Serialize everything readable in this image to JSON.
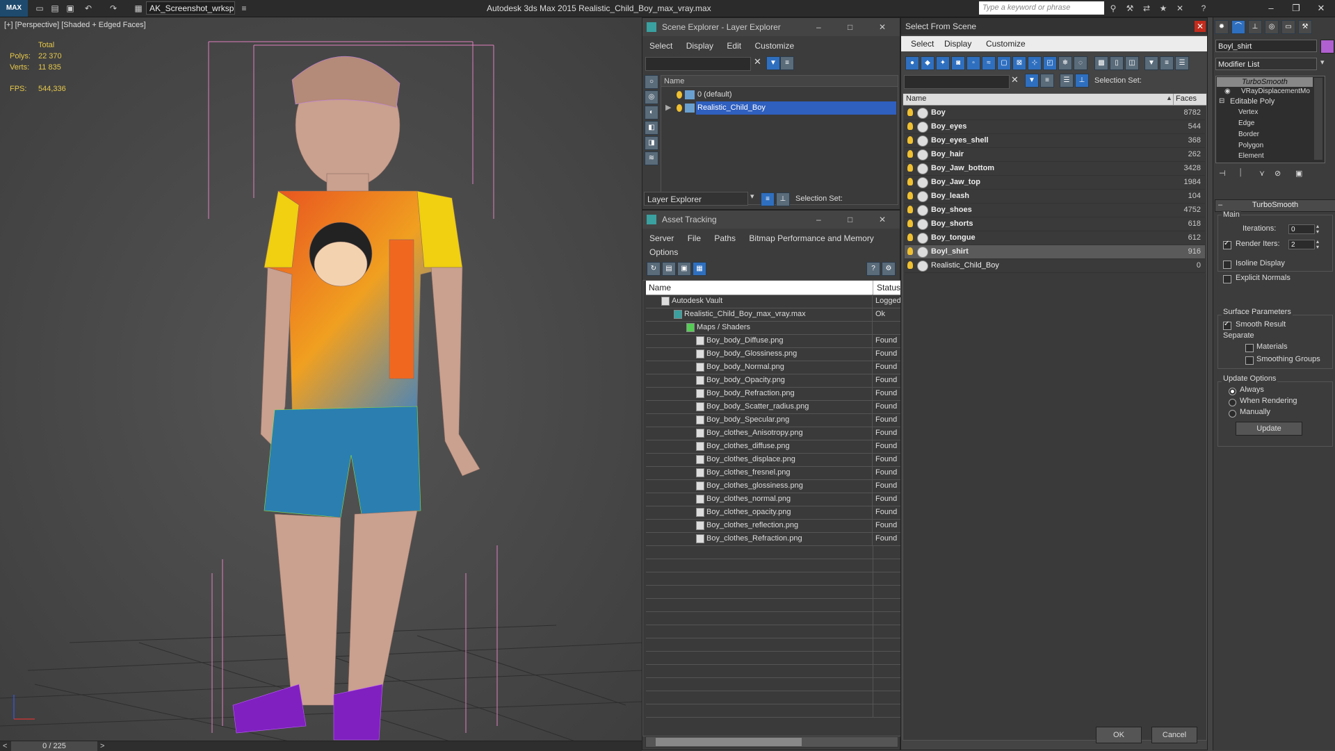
{
  "titlebar": {
    "workspace": "AK_Screenshot_wrksp",
    "app_title": "Autodesk 3ds Max  2015     Realistic_Child_Boy_max_vray.max",
    "search_placeholder": "Type a keyword or phrase",
    "logo": "MAX"
  },
  "viewport": {
    "label": "[+] [Perspective] [Shaded + Edged Faces]",
    "stats": {
      "total_label": "Total",
      "polys_label": "Polys:",
      "polys": "22 370",
      "verts_label": "Verts:",
      "verts": "11 835",
      "fps_label": "FPS:",
      "fps": "544,336"
    }
  },
  "timeline": {
    "frame": "0 / 225",
    "prev": "<",
    "next": ">"
  },
  "scene_explorer": {
    "title": "Scene Explorer - Layer Explorer",
    "menu": [
      "Select",
      "Display",
      "Edit",
      "Customize"
    ],
    "column_name": "Name",
    "layers": [
      "0 (default)",
      "Realistic_Child_Boy"
    ],
    "footer_dropdown": "Layer Explorer",
    "selection_set_label": "Selection Set:"
  },
  "asset_tracking": {
    "title": "Asset Tracking",
    "menu": [
      "Server",
      "File",
      "Paths",
      "Bitmap Performance and Memory",
      "Options"
    ],
    "columns": [
      "Name",
      "Status"
    ],
    "rows": [
      {
        "name": "Autodesk Vault",
        "status": "Logged"
      },
      {
        "name": "Realistic_Child_Boy_max_vray.max",
        "status": "Ok"
      },
      {
        "name": "Maps / Shaders",
        "status": ""
      },
      {
        "name": "Boy_body_Diffuse.png",
        "status": "Found"
      },
      {
        "name": "Boy_body_Glossiness.png",
        "status": "Found"
      },
      {
        "name": "Boy_body_Normal.png",
        "status": "Found"
      },
      {
        "name": "Boy_body_Opacity.png",
        "status": "Found"
      },
      {
        "name": "Boy_body_Refraction.png",
        "status": "Found"
      },
      {
        "name": "Boy_body_Scatter_radius.png",
        "status": "Found"
      },
      {
        "name": "Boy_body_Specular.png",
        "status": "Found"
      },
      {
        "name": "Boy_clothes_Anisotropy.png",
        "status": "Found"
      },
      {
        "name": "Boy_clothes_diffuse.png",
        "status": "Found"
      },
      {
        "name": "Boy_clothes_displace.png",
        "status": "Found"
      },
      {
        "name": "Boy_clothes_fresnel.png",
        "status": "Found"
      },
      {
        "name": "Boy_clothes_glossiness.png",
        "status": "Found"
      },
      {
        "name": "Boy_clothes_normal.png",
        "status": "Found"
      },
      {
        "name": "Boy_clothes_opacity.png",
        "status": "Found"
      },
      {
        "name": "Boy_clothes_reflection.png",
        "status": "Found"
      },
      {
        "name": "Boy_clothes_Refraction.png",
        "status": "Found"
      }
    ]
  },
  "select_from_scene": {
    "title": "Select From Scene",
    "menu": [
      "Select",
      "Display",
      "Customize"
    ],
    "selection_set_label": "Selection Set:",
    "columns": [
      "Name",
      "Faces"
    ],
    "rows": [
      {
        "name": "Boy",
        "faces": "8782"
      },
      {
        "name": "Boy_eyes",
        "faces": "544"
      },
      {
        "name": "Boy_eyes_shell",
        "faces": "368"
      },
      {
        "name": "Boy_hair",
        "faces": "262"
      },
      {
        "name": "Boy_Jaw_bottom",
        "faces": "3428"
      },
      {
        "name": "Boy_Jaw_top",
        "faces": "1984"
      },
      {
        "name": "Boy_leash",
        "faces": "104"
      },
      {
        "name": "Boy_shoes",
        "faces": "4752"
      },
      {
        "name": "Boy_shorts",
        "faces": "618"
      },
      {
        "name": "Boy_tongue",
        "faces": "612"
      },
      {
        "name": "Boyl_shirt",
        "faces": "916"
      },
      {
        "name": "Realistic_Child_Boy",
        "faces": "0"
      }
    ],
    "ok": "OK",
    "cancel": "Cancel"
  },
  "command_panel": {
    "object_name": "Boyl_shirt",
    "modifier_list": "Modifier List",
    "stack": [
      "TurboSmooth",
      "VRayDisplacementMo",
      "Editable Poly",
      "Vertex",
      "Edge",
      "Border",
      "Polygon",
      "Element"
    ],
    "rollout_title": "TurboSmooth",
    "main_label": "Main",
    "iterations_label": "Iterations:",
    "iterations": "0",
    "render_iters_label": "Render Iters:",
    "render_iters": "2",
    "isoline_label": "Isoline Display",
    "explicit_normals_label": "Explicit Normals",
    "surface_params_label": "Surface Parameters",
    "smooth_result_label": "Smooth Result",
    "separate_label": "Separate",
    "materials_label": "Materials",
    "smoothing_groups_label": "Smoothing Groups",
    "update_options_label": "Update Options",
    "always_label": "Always",
    "when_rendering_label": "When Rendering",
    "manually_label": "Manually",
    "update_button": "Update"
  },
  "colors": {
    "selection": "#2f5fbf",
    "stats": "#e6c84a"
  }
}
